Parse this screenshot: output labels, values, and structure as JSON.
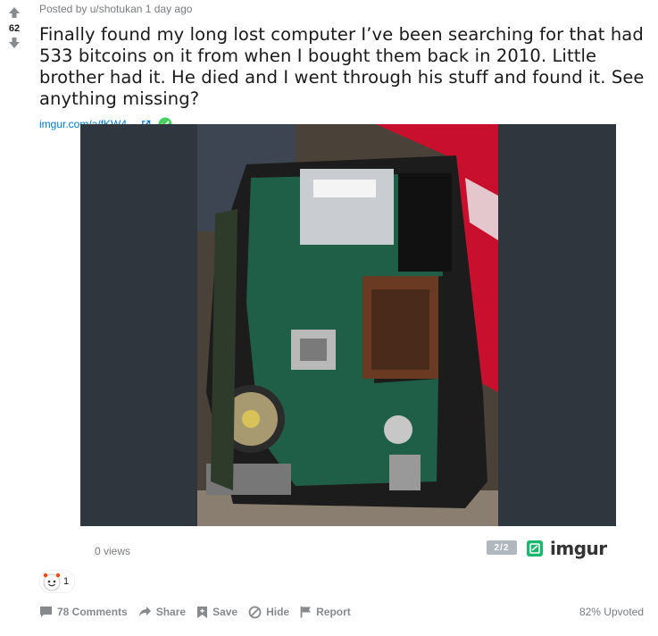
{
  "post": {
    "vote_count": "62",
    "meta": "Posted by u/shotukan 1 day ago",
    "title": "Finally found my long lost computer I’ve been searching for that had 533 bitcoins on it from when I bought them back in 2010. Little brother had it. He died and I went through his stuff and found it. See anything missing?",
    "link_text": "imgur.com/a/fKW4...",
    "icons": {
      "upvote": "arrow-up-icon",
      "downvote": "arrow-down-icon",
      "external": "external-link-icon",
      "verified": "check-circle-icon"
    }
  },
  "media": {
    "views": "0 views",
    "page_indicator": "2/2",
    "provider": "imgur",
    "frame_color": "#2f363e",
    "provider_color": "#1bb76e"
  },
  "awards": {
    "count": "1"
  },
  "actions": {
    "comments": "78 Comments",
    "share": "Share",
    "save": "Save",
    "hide": "Hide",
    "report": "Report",
    "upvoted": "82% Upvoted"
  }
}
